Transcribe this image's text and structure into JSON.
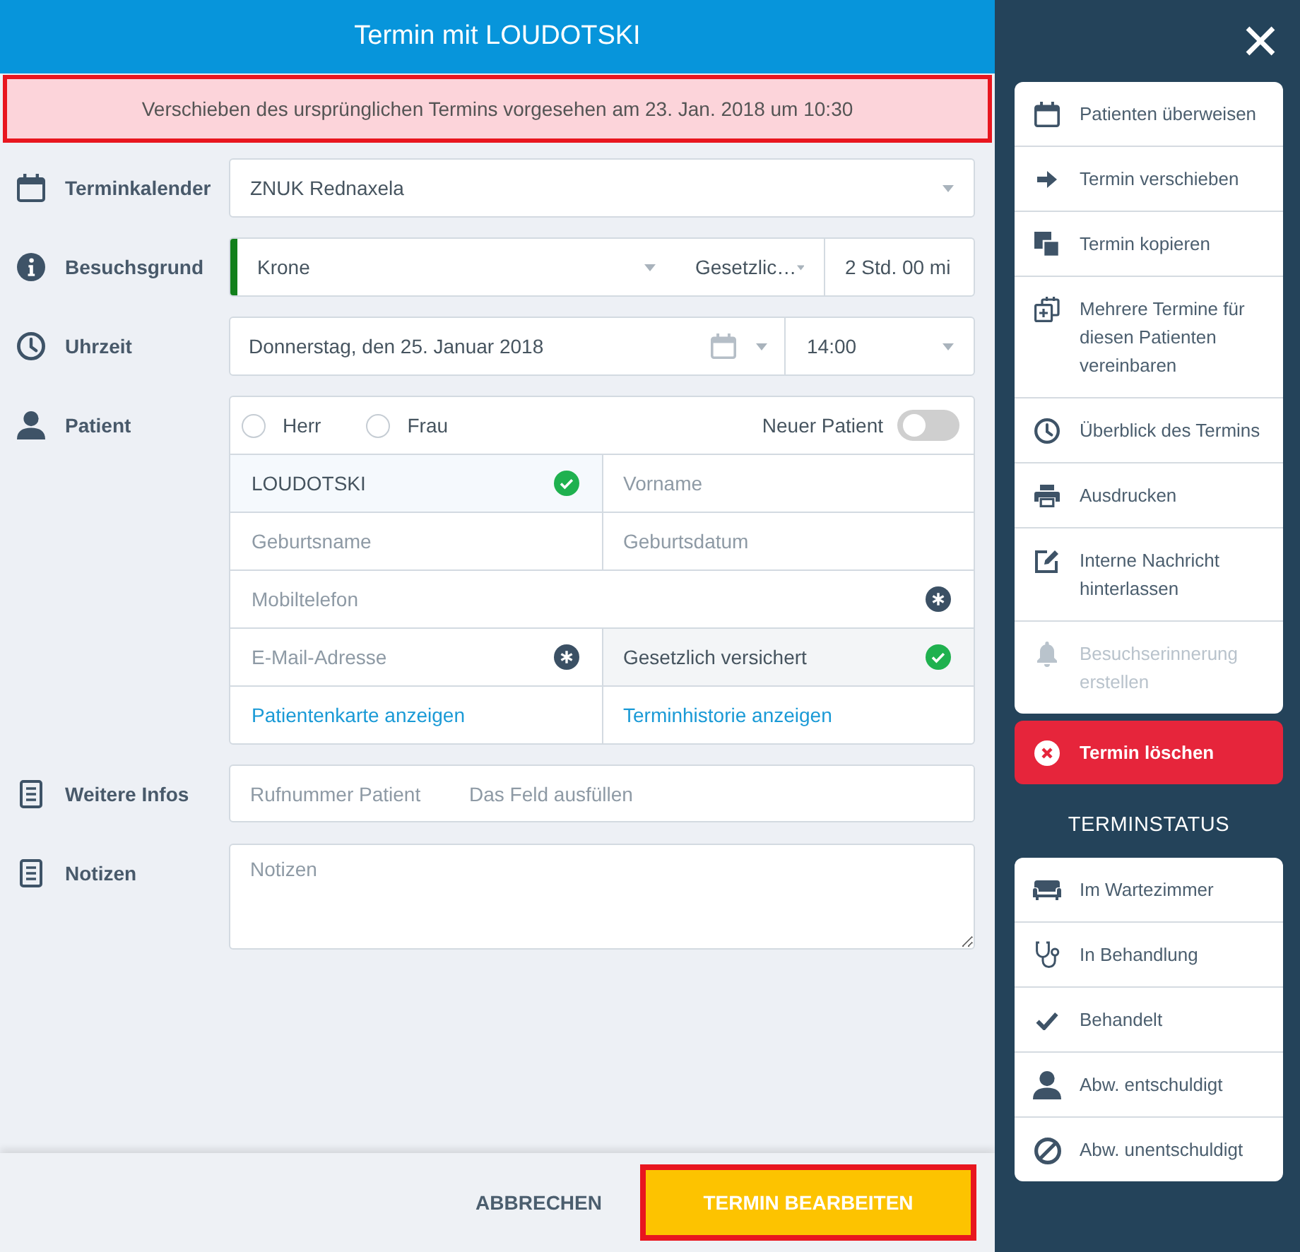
{
  "dialog": {
    "title": "Termin mit LOUDOTSKI"
  },
  "banner": {
    "text": "Verschieben des ursprünglichen Termins vorgesehen am 23. Jan. 2018 um 10:30",
    "highlighted": true
  },
  "form": {
    "rows": [
      {
        "kind": "select",
        "label": "Terminkalender",
        "value": "ZNUK Rednaxela"
      },
      {
        "kind": "visit_reason",
        "label": "Besuchsgrund",
        "reason": "Krone",
        "color": "#12801b",
        "insurance": "Gesetzlic…",
        "duration": "2 Std. 00 mi"
      },
      {
        "kind": "datetime",
        "label": "Uhrzeit",
        "date": "Donnerstag, den 25. Januar 2018",
        "time": "14:00"
      },
      {
        "kind": "patient",
        "label": "Patient",
        "salutations": [
          {
            "label": "Herr",
            "selected": false
          },
          {
            "label": "Frau",
            "selected": false
          }
        ],
        "new_patient": {
          "label": "Neuer Patient",
          "on": false
        },
        "field_rows": [
          {
            "cells": [
              {
                "kind": "input",
                "value": "LOUDOTSKI",
                "valid": true,
                "required": false
              },
              {
                "kind": "input",
                "placeholder": "Vorname",
                "valid": false,
                "required": false
              }
            ]
          },
          {
            "cells": [
              {
                "kind": "input",
                "placeholder": "Geburtsname",
                "valid": false,
                "required": false
              },
              {
                "kind": "input",
                "placeholder": "Geburtsdatum",
                "valid": false,
                "required": false
              }
            ]
          },
          {
            "cells": [
              {
                "kind": "input",
                "placeholder": "Mobiltelefon",
                "valid": false,
                "required": true
              }
            ]
          },
          {
            "cells": [
              {
                "kind": "input",
                "placeholder": "E-Mail-Adresse",
                "valid": false,
                "required": true
              },
              {
                "kind": "select",
                "value": "Gesetzlich versichert",
                "valid": true,
                "required": false
              }
            ]
          }
        ],
        "links": [
          "Patientenkarte anzeigen",
          "Terminhistorie anzeigen"
        ]
      },
      {
        "kind": "info",
        "label": "Weitere Infos",
        "field_label": "Rufnummer Patient",
        "placeholder": "Das Feld ausfüllen"
      },
      {
        "kind": "textarea",
        "label": "Notizen",
        "placeholder": "Notizen"
      }
    ]
  },
  "footer": {
    "buttons": [
      {
        "kind": "text",
        "label": "ABBRECHEN",
        "highlighted": false
      },
      {
        "kind": "primary",
        "label": "TERMIN BEARBEITEN",
        "highlighted": true
      }
    ]
  },
  "sidebar": {
    "actions": [
      {
        "label": "Patienten überweisen",
        "disabled": false
      },
      {
        "label": "Termin verschieben",
        "disabled": false
      },
      {
        "label": "Termin kopieren",
        "disabled": false
      },
      {
        "label": "Mehrere Termine für diesen Patienten vereinbaren",
        "disabled": false
      },
      {
        "label": "Überblick des Termins",
        "disabled": false
      },
      {
        "label": "Ausdrucken",
        "disabled": false
      },
      {
        "label": "Interne Nachricht hinterlassen",
        "disabled": false
      },
      {
        "label": "Besuchserinnerung erstellen",
        "disabled": true
      }
    ],
    "delete_button": {
      "label": "Termin löschen"
    },
    "status_heading": "TERMINSTATUS",
    "statuses": [
      {
        "label": "Im Wartezimmer"
      },
      {
        "label": "In Behandlung"
      },
      {
        "label": "Behandelt"
      },
      {
        "label": "Abw. entschuldigt"
      },
      {
        "label": "Abw. unentschuldigt"
      }
    ]
  }
}
